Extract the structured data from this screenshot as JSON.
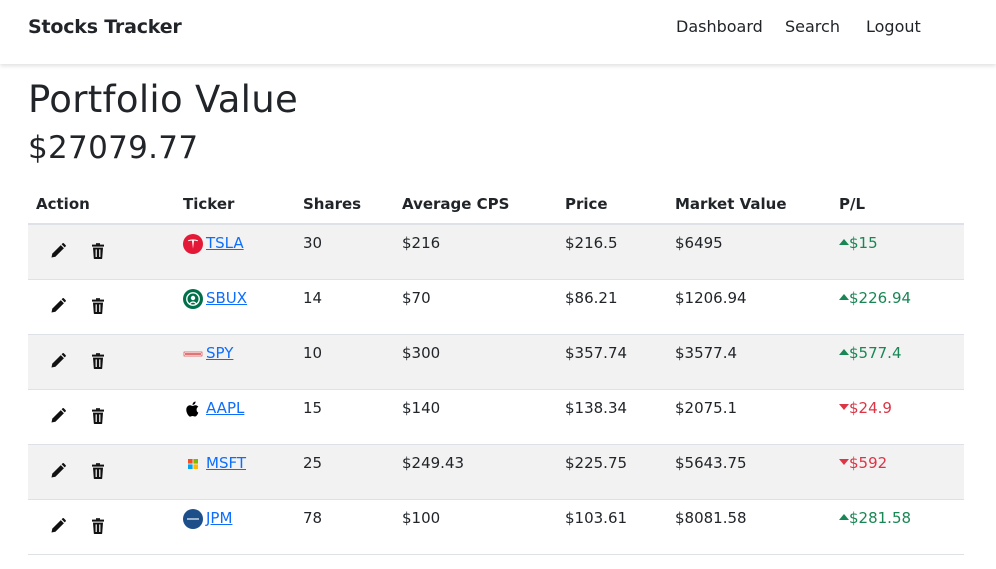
{
  "nav": {
    "brand": "Stocks Tracker",
    "links": [
      "Dashboard",
      "Search",
      "Logout"
    ]
  },
  "page": {
    "title": "Portfolio Value",
    "value": "$27079.77"
  },
  "table": {
    "headers": [
      "Action",
      "Ticker",
      "Shares",
      "Average CPS",
      "Price",
      "Market Value",
      "P/L"
    ],
    "rows": [
      {
        "ticker": "TSLA",
        "logo": "tesla-logo-icon",
        "shares": "30",
        "avg_cps": "$216",
        "price": "$216.5",
        "market_value": "$6495",
        "pl": "$15",
        "direction": "up"
      },
      {
        "ticker": "SBUX",
        "logo": "starbucks-logo-icon",
        "shares": "14",
        "avg_cps": "$70",
        "price": "$86.21",
        "market_value": "$1206.94",
        "pl": "$226.94",
        "direction": "up"
      },
      {
        "ticker": "SPY",
        "logo": "spdr-logo-icon",
        "shares": "10",
        "avg_cps": "$300",
        "price": "$357.74",
        "market_value": "$3577.4",
        "pl": "$577.4",
        "direction": "up"
      },
      {
        "ticker": "AAPL",
        "logo": "apple-logo-icon",
        "shares": "15",
        "avg_cps": "$140",
        "price": "$138.34",
        "market_value": "$2075.1",
        "pl": "$24.9",
        "direction": "down"
      },
      {
        "ticker": "MSFT",
        "logo": "microsoft-logo-icon",
        "shares": "25",
        "avg_cps": "$249.43",
        "price": "$225.75",
        "market_value": "$5643.75",
        "pl": "$592",
        "direction": "down"
      },
      {
        "ticker": "JPM",
        "logo": "jpmorgan-logo-icon",
        "shares": "78",
        "avg_cps": "$100",
        "price": "$103.61",
        "market_value": "$8081.58",
        "pl": "$281.58",
        "direction": "up"
      }
    ]
  },
  "icons": {
    "edit": "pencil-icon",
    "delete": "trash-icon",
    "up": "caret-up-icon",
    "down": "caret-down-icon"
  },
  "colors": {
    "link": "#0d6efd",
    "profit": "#198754",
    "loss": "#dc3545",
    "stripe": "#f2f2f2"
  }
}
